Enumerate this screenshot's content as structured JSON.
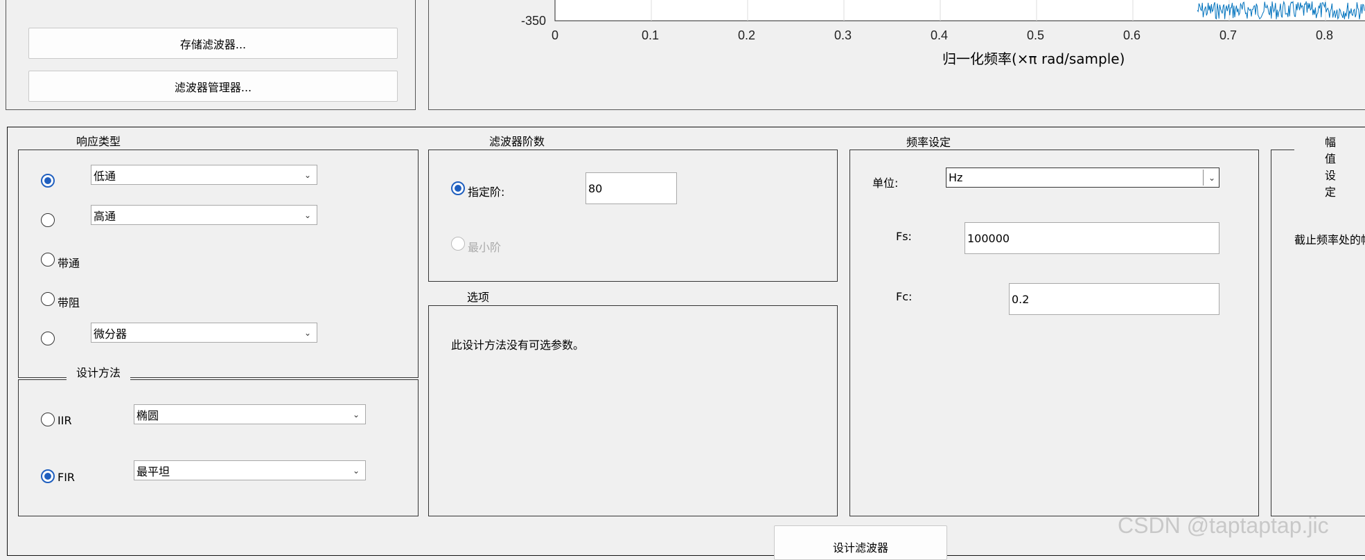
{
  "top_left": {
    "store_button": "存储滤波器...",
    "manager_button": "滤波器管理器..."
  },
  "plot": {
    "y_tick": "-350",
    "x_ticks": [
      "0",
      "0.1",
      "0.2",
      "0.3",
      "0.4",
      "0.5",
      "0.6",
      "0.7",
      "0.8"
    ],
    "xlabel": "归一化频率(×π rad/sample)",
    "trace_color": "#0072bd"
  },
  "response_type": {
    "title": "响应类型",
    "lowpass": "低通",
    "highpass": "高通",
    "bandpass": "带通",
    "bandstop": "带阻",
    "differentiator": "微分器"
  },
  "design_method": {
    "title": "设计方法",
    "iir_label": "IIR",
    "iir_value": "椭圆",
    "fir_label": "FIR",
    "fir_value": "最平坦"
  },
  "filter_order": {
    "title": "滤波器阶数",
    "specify_label": "指定阶:",
    "specify_value": "80",
    "minimum_label": "最小阶"
  },
  "options": {
    "title": "选项",
    "text": "此设计方法没有可选参数。"
  },
  "freq_spec": {
    "title": "频率设定",
    "unit_label": "单位:",
    "unit_value": "Hz",
    "fs_label": "Fs:",
    "fs_value": "100000",
    "fc_label": "Fc:",
    "fc_value": "0.2"
  },
  "mag_spec": {
    "title": "幅值设定",
    "text": "截止频率处的幅"
  },
  "design_button": "设计滤波器",
  "watermark": "CSDN @taptaptap.jic"
}
